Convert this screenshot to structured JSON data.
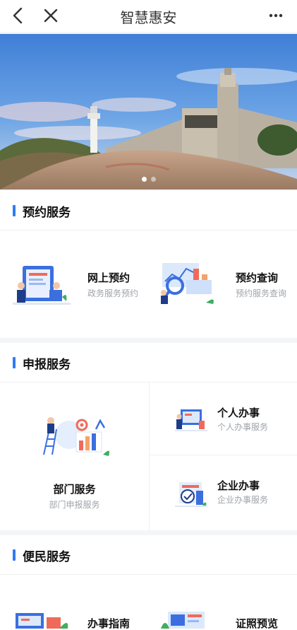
{
  "header": {
    "title": "智慧惠安"
  },
  "banner": {
    "slide_count": 2,
    "active_slide": 0
  },
  "sections": {
    "booking": {
      "title": "预约服务",
      "items": [
        {
          "name": "网上预约",
          "sub": "政务服务预约"
        },
        {
          "name": "预约查询",
          "sub": "预约服务查询"
        }
      ]
    },
    "report": {
      "title": "申报服务",
      "dept": {
        "name": "部门服务",
        "sub": "部门申报服务"
      },
      "personal": {
        "name": "个人办事",
        "sub": "个人办事服务"
      },
      "enterprise": {
        "name": "企业办事",
        "sub": "企业办事服务"
      }
    },
    "convenience": {
      "title": "便民服务",
      "items": [
        {
          "name": "办事指南"
        },
        {
          "name": "证照预览"
        }
      ]
    }
  },
  "colors": {
    "accent": "#2f7bf6",
    "subtext": "#a0a4aa"
  }
}
